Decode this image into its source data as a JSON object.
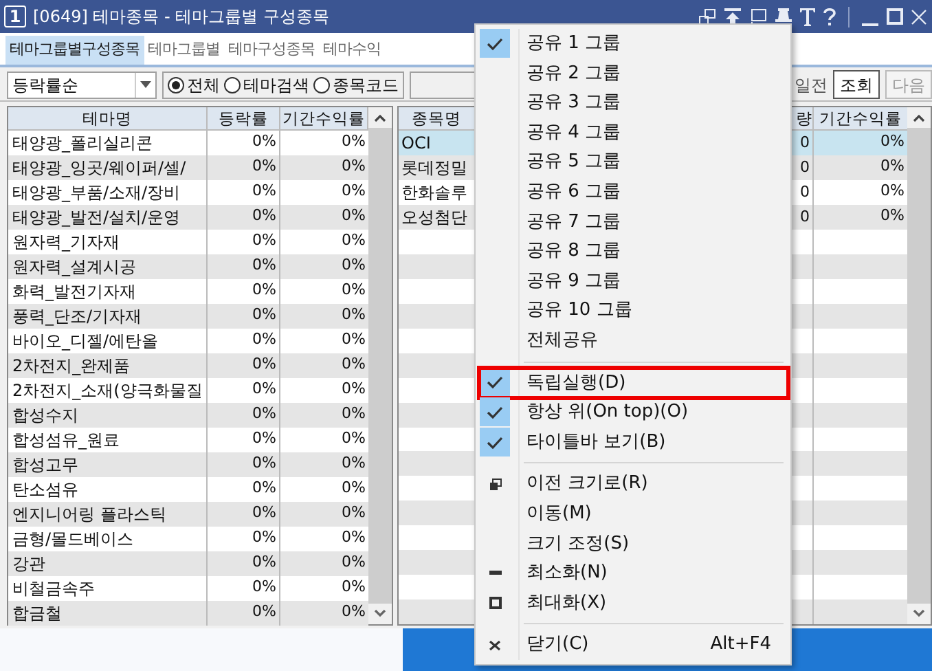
{
  "window": {
    "badge": "1",
    "title": "[0649] 테마종목 - 테마그룹별 구성종목"
  },
  "tabs": [
    {
      "label": "테마그룹별구성종목",
      "selected": true
    },
    {
      "label": "테마그룹별",
      "selected": false
    },
    {
      "label": "테마구성종목",
      "selected": false
    },
    {
      "label": "테마수익",
      "selected": false
    }
  ],
  "toolbar": {
    "sort_select": {
      "value": "등락률순"
    },
    "radios": [
      {
        "label": "전체",
        "selected": true
      },
      {
        "label": "테마검색",
        "selected": false
      },
      {
        "label": "종목코드",
        "selected": false
      }
    ],
    "period_label": "일전",
    "buttons": [
      {
        "label": "조회",
        "disabled": false
      },
      {
        "label": "다음",
        "disabled": true
      }
    ]
  },
  "theme_table": {
    "columns": [
      "테마명",
      "등락률",
      "기간수익률"
    ],
    "rows": [
      {
        "name": "태양광_폴리실리콘",
        "change": "0%",
        "period_return": "0%"
      },
      {
        "name": "태양광_잉곳/웨이퍼/셀/",
        "change": "0%",
        "period_return": "0%"
      },
      {
        "name": "태양광_부품/소재/장비",
        "change": "0%",
        "period_return": "0%"
      },
      {
        "name": "태양광_발전/설치/운영",
        "change": "0%",
        "period_return": "0%"
      },
      {
        "name": "원자력_기자재",
        "change": "0%",
        "period_return": "0%"
      },
      {
        "name": "원자력_설계시공",
        "change": "0%",
        "period_return": "0%"
      },
      {
        "name": "화력_발전기자재",
        "change": "0%",
        "period_return": "0%"
      },
      {
        "name": "풍력_단조/기자재",
        "change": "0%",
        "period_return": "0%"
      },
      {
        "name": "바이오_디젤/에탄올",
        "change": "0%",
        "period_return": "0%"
      },
      {
        "name": "2차전지_완제품",
        "change": "0%",
        "period_return": "0%"
      },
      {
        "name": "2차전지_소재(양극화물질",
        "change": "0%",
        "period_return": "0%"
      },
      {
        "name": "합성수지",
        "change": "0%",
        "period_return": "0%"
      },
      {
        "name": "합성섬유_원료",
        "change": "0%",
        "period_return": "0%"
      },
      {
        "name": "합성고무",
        "change": "0%",
        "period_return": "0%"
      },
      {
        "name": "탄소섬유",
        "change": "0%",
        "period_return": "0%"
      },
      {
        "name": "엔지니어링 플라스틱",
        "change": "0%",
        "period_return": "0%"
      },
      {
        "name": "금형/몰드베이스",
        "change": "0%",
        "period_return": "0%"
      },
      {
        "name": "강관",
        "change": "0%",
        "period_return": "0%"
      },
      {
        "name": "비철금속주",
        "change": "0%",
        "period_return": "0%"
      },
      {
        "name": "합금철",
        "change": "0%",
        "period_return": "0%"
      }
    ]
  },
  "stock_table": {
    "columns": [
      "종목명",
      "량",
      "기간수익률"
    ],
    "rows": [
      {
        "name": "OCI",
        "column_2": "0",
        "period_return": "0%",
        "selected": true
      },
      {
        "name": "롯데정밀",
        "column_2": "0",
        "period_return": "0%",
        "selected": false
      },
      {
        "name": "한화솔루",
        "column_2": "0",
        "period_return": "0%",
        "selected": false
      },
      {
        "name": "오성첨단",
        "column_2": "0",
        "period_return": "0%",
        "selected": false
      }
    ]
  },
  "context_menu": {
    "items": [
      {
        "kind": "option",
        "label": "공유 1 그룹",
        "checked": true,
        "outlined": false
      },
      {
        "kind": "option",
        "label": "공유 2 그룹",
        "checked": false,
        "outlined": false
      },
      {
        "kind": "option",
        "label": "공유 3 그룹",
        "checked": false,
        "outlined": false
      },
      {
        "kind": "option",
        "label": "공유 4 그룹",
        "checked": false,
        "outlined": false
      },
      {
        "kind": "option",
        "label": "공유 5 그룹",
        "checked": false,
        "outlined": false
      },
      {
        "kind": "option",
        "label": "공유 6 그룹",
        "checked": false,
        "outlined": false
      },
      {
        "kind": "option",
        "label": "공유 7 그룹",
        "checked": false,
        "outlined": false
      },
      {
        "kind": "option",
        "label": "공유 8 그룹",
        "checked": false,
        "outlined": false
      },
      {
        "kind": "option",
        "label": "공유 9 그룹",
        "checked": false,
        "outlined": false
      },
      {
        "kind": "option",
        "label": "공유 10 그룹",
        "checked": false,
        "outlined": false
      },
      {
        "kind": "option",
        "label": "전체공유",
        "checked": false,
        "outlined": false
      },
      {
        "kind": "separator"
      },
      {
        "kind": "option",
        "label": "독립실행(D)",
        "checked": true,
        "outlined": true
      },
      {
        "kind": "option",
        "label": "항상 위(On top)(O)",
        "checked": true,
        "outlined": false
      },
      {
        "kind": "option",
        "label": "타이틀바 보기(B)",
        "checked": true,
        "outlined": false
      },
      {
        "kind": "separator"
      },
      {
        "kind": "restore",
        "label": "이전 크기로(R)",
        "outlined": false
      },
      {
        "kind": "command",
        "label": "이동(M)",
        "outlined": false
      },
      {
        "kind": "command",
        "label": "크기 조정(S)",
        "outlined": false
      },
      {
        "kind": "minimize",
        "label": "최소화(N)",
        "outlined": false
      },
      {
        "kind": "maximize",
        "label": "최대화(X)",
        "outlined": false
      },
      {
        "kind": "separator"
      },
      {
        "kind": "close",
        "label": "닫기(C)",
        "shortcut": "Alt+F4",
        "outlined": false
      }
    ]
  }
}
